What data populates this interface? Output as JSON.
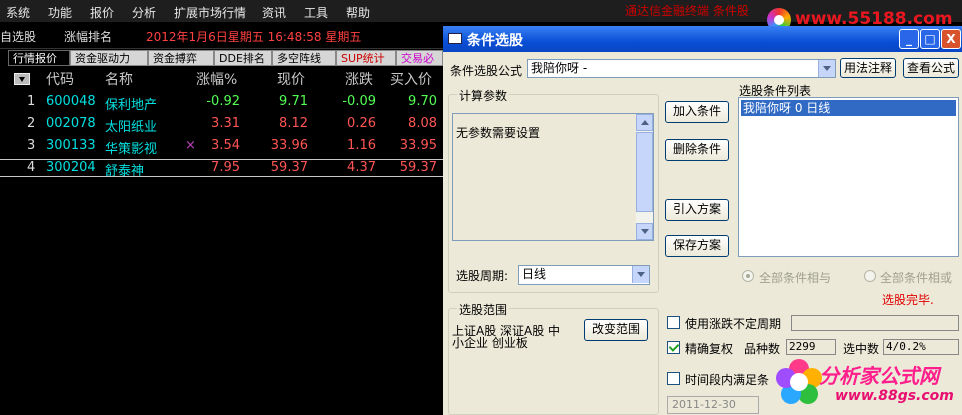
{
  "menu": [
    "系统",
    "功能",
    "报价",
    "分析",
    "扩展市场行情",
    "资讯",
    "工具",
    "帮助"
  ],
  "promo_text": "通达信金融终端  条件股",
  "logo_text": "www.55188.com",
  "toolbar": {
    "watchlist": "自选股",
    "ranking": "涨幅排名",
    "datetime": "2012年1月6日星期五  16:48:58 星期五"
  },
  "tabs": [
    "行情报价",
    "资金驱动力",
    "资金搏弈",
    "DDE排名",
    "多空阵线",
    "SUP统计",
    "交易必"
  ],
  "table": {
    "columns": [
      "代码",
      "名称",
      "涨幅%",
      "现价",
      "涨跌",
      "买入价"
    ],
    "rows": [
      {
        "idx": "1",
        "code": "600048",
        "name": "保利地产",
        "flag": "",
        "pct": "-0.92",
        "price": "9.71",
        "chg": "-0.09",
        "bid": "9.70"
      },
      {
        "idx": "2",
        "code": "002078",
        "name": "太阳纸业",
        "flag": "",
        "pct": "3.31",
        "price": "8.12",
        "chg": "0.26",
        "bid": "8.08"
      },
      {
        "idx": "3",
        "code": "300133",
        "name": "华策影视",
        "flag": "×",
        "pct": "3.54",
        "price": "33.96",
        "chg": "1.16",
        "bid": "33.95"
      },
      {
        "idx": "4",
        "code": "300204",
        "name": "舒泰神",
        "flag": "",
        "pct": "7.95",
        "price": "59.37",
        "chg": "4.37",
        "bid": "59.37"
      }
    ]
  },
  "dialog": {
    "title": "条件选股",
    "window_buttons": {
      "minimize": "_",
      "maximize": "□",
      "close": "X"
    },
    "formula_label": "条件选股公式",
    "formula_value": "我陪你呀    -",
    "usage_button": "用法注释",
    "view_formula_button": "查看公式",
    "params_group": "计算参数",
    "params_text": "无参数需要设置",
    "period_label": "选股周期:",
    "period_value": "日线",
    "add_button": "加入条件",
    "delete_button": "删除条件",
    "import_button": "引入方案",
    "save_button": "保存方案",
    "list_label": "选股条件列表",
    "list_items": [
      "我陪你呀      0  日线"
    ],
    "radio_and": "全部条件相与",
    "radio_or": "全部条件相或",
    "status": "选股完毕.",
    "scope_group": "选股范围",
    "scope_text_1": "上证A股 深证A股 中",
    "scope_text_2": "小企业 创业板",
    "change_scope_button": "改变范围",
    "opt_period": "使用涨跌不定周期",
    "opt_adjust": "精确复权",
    "count_label": "品种数",
    "count_value": "2299",
    "selected_label": "选中数",
    "selected_value": "4/0.2%",
    "opt_time": "时间段内满足条",
    "date_value": "2011-12-30"
  },
  "watermark": {
    "line1": "分析家公式网",
    "line2": "www.88gs.com"
  },
  "colors": {
    "red": "#ff5555",
    "green": "#54ff54",
    "cyan": "#00e0e0",
    "yellow": "#ffff40",
    "title_blue": "#0a4fd6"
  }
}
